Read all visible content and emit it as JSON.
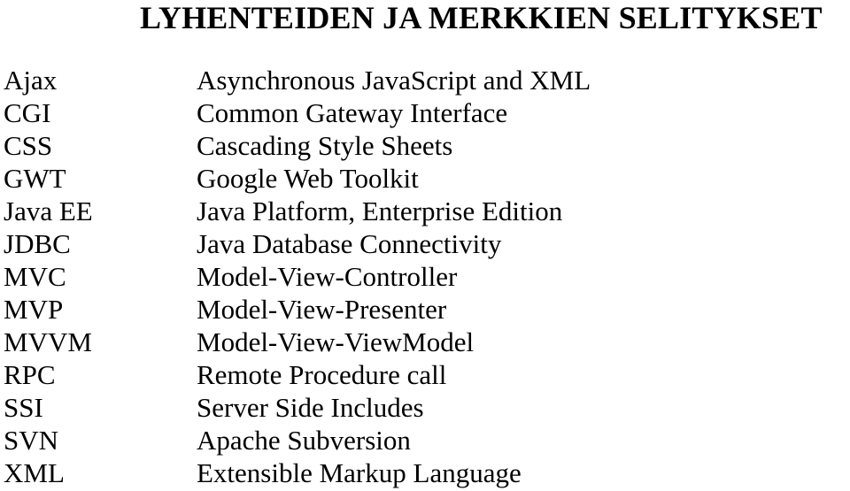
{
  "title": "LYHENTEIDEN JA MERKKIEN SELITYKSET",
  "entries": [
    {
      "abbr": "Ajax",
      "definition": "Asynchronous JavaScript and XML"
    },
    {
      "abbr": "CGI",
      "definition": "Common Gateway Interface"
    },
    {
      "abbr": "CSS",
      "definition": "Cascading Style Sheets"
    },
    {
      "abbr": "GWT",
      "definition": "Google Web Toolkit"
    },
    {
      "abbr": "Java EE",
      "definition": "Java Platform, Enterprise Edition"
    },
    {
      "abbr": "JDBC",
      "definition": "Java Database Connectivity"
    },
    {
      "abbr": "MVC",
      "definition": "Model-View-Controller"
    },
    {
      "abbr": "MVP",
      "definition": "Model-View-Presenter"
    },
    {
      "abbr": "MVVM",
      "definition": "Model-View-ViewModel"
    },
    {
      "abbr": "RPC",
      "definition": "Remote Procedure call"
    },
    {
      "abbr": "SSI",
      "definition": "Server Side Includes"
    },
    {
      "abbr": "SVN",
      "definition": "Apache Subversion"
    },
    {
      "abbr": "XML",
      "definition": "Extensible Markup Language"
    }
  ]
}
